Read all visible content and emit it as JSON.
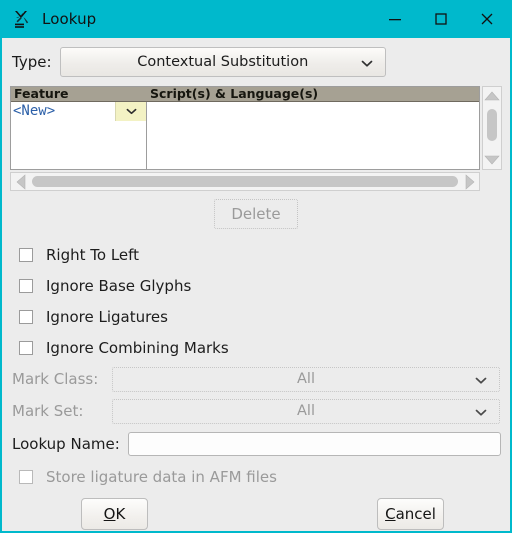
{
  "window": {
    "title": "Lookup",
    "icon": "fontforge-glyph-icon",
    "titlebar_color": "#00b9cc",
    "background_color": "#ececec",
    "controls": [
      {
        "name": "minimize",
        "glyph": "minimize-icon"
      },
      {
        "name": "maximize",
        "glyph": "maximize-icon"
      },
      {
        "name": "close",
        "glyph": "close-icon"
      }
    ]
  },
  "type_row": {
    "label": "Type:",
    "value": "Contextual Substitution",
    "options": [
      "Contextual Substitution"
    ]
  },
  "matrix": {
    "columns": [
      "Feature",
      "Script(s) & Language(s)"
    ],
    "rows": [
      {
        "feature": "<New>",
        "scripts": ""
      }
    ],
    "feature_text_color": "#2b5fa8",
    "dropper_color": "#f3f2c4",
    "header_color": "#a6a193"
  },
  "delete_button": {
    "label": "Delete",
    "enabled": false
  },
  "flags": [
    {
      "label": "Right To Left",
      "checked": false,
      "enabled": true
    },
    {
      "label": "Ignore Base Glyphs",
      "checked": false,
      "enabled": true
    },
    {
      "label": "Ignore Ligatures",
      "checked": false,
      "enabled": true
    },
    {
      "label": "Ignore Combining Marks",
      "checked": false,
      "enabled": true
    }
  ],
  "mark_class": {
    "label": "Mark Class:",
    "value": "All",
    "enabled": false
  },
  "mark_set": {
    "label": "Mark Set:",
    "value": "All",
    "enabled": false
  },
  "lookup_name": {
    "label": "Lookup Name:",
    "value": "",
    "placeholder": ""
  },
  "afm": {
    "label": "Store ligature data in AFM files",
    "checked": false,
    "enabled": false
  },
  "buttons": {
    "ok": {
      "prefix": "",
      "accel": "O",
      "suffix": "K"
    },
    "cancel": {
      "prefix": "",
      "accel": "C",
      "suffix": "ancel"
    }
  }
}
